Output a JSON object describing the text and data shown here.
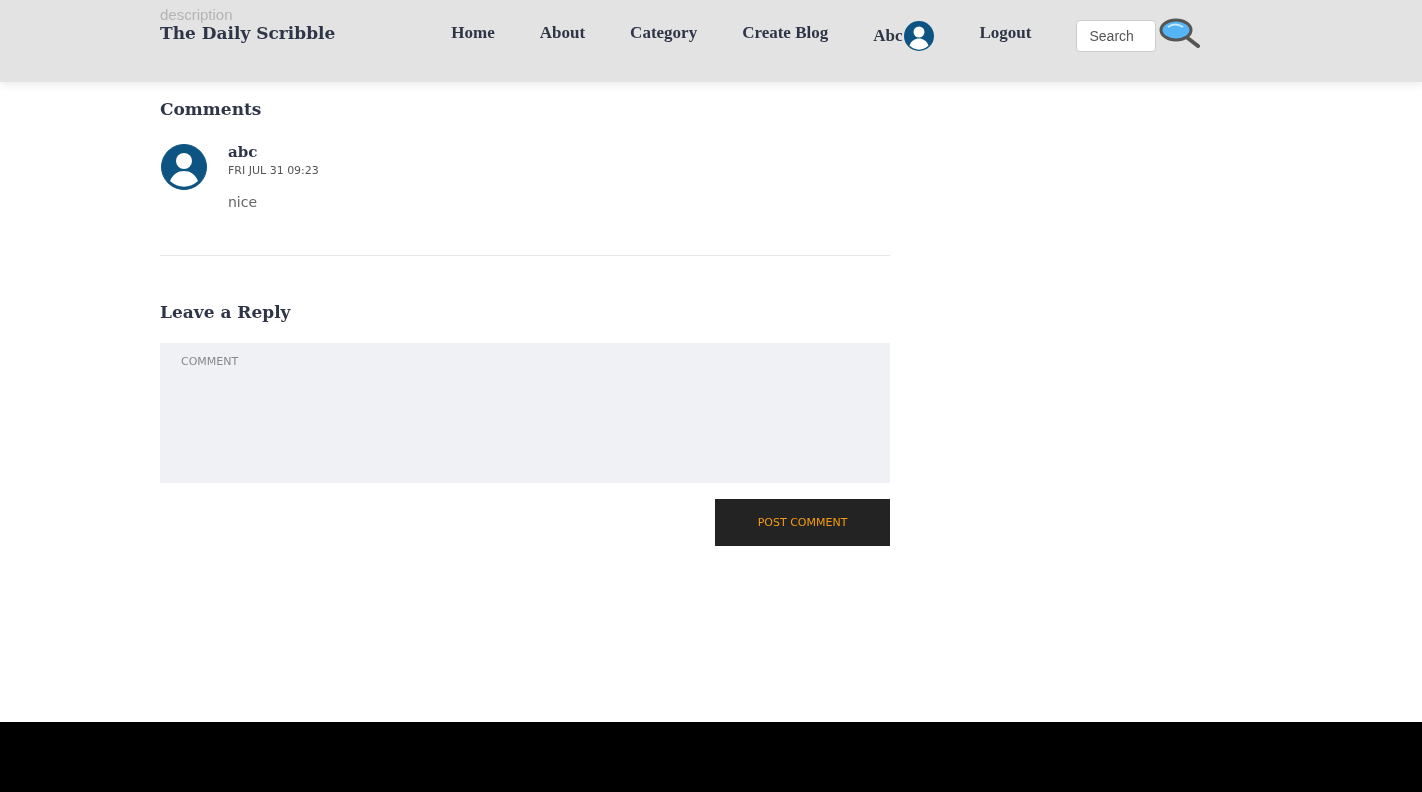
{
  "behind_header_text": "description",
  "header": {
    "brand": "The Daily Scribble",
    "nav": [
      {
        "label": "Home",
        "kind": "link"
      },
      {
        "label": "About",
        "kind": "link"
      },
      {
        "label": "Category",
        "kind": "link"
      },
      {
        "label": "Create Blog",
        "kind": "link"
      },
      {
        "label": "Abc",
        "kind": "user"
      },
      {
        "label": "Logout",
        "kind": "link"
      }
    ],
    "search": {
      "placeholder": "Search"
    }
  },
  "comments": {
    "title": "Comments",
    "items": [
      {
        "author": "abc",
        "date": "FRI JUL 31 09:23",
        "text": "nice"
      }
    ]
  },
  "reply": {
    "title": "Leave a Reply",
    "comment_placeholder": "COMMENT",
    "button": "POST COMMENT"
  }
}
